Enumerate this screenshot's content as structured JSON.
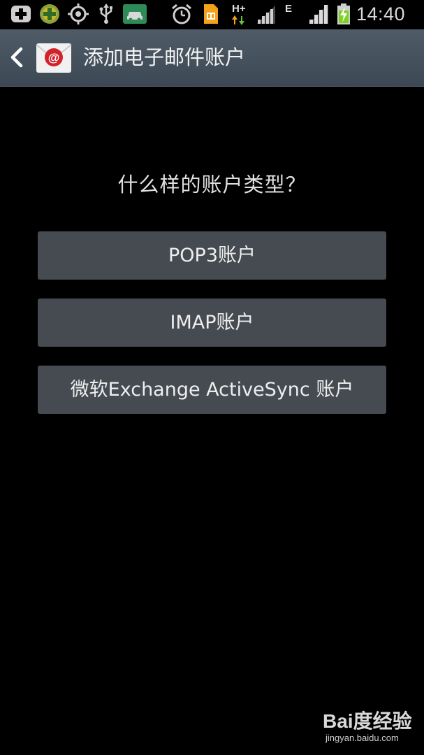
{
  "status_bar": {
    "network_type": "H+",
    "network_type_2": "E",
    "time": "14:40"
  },
  "action_bar": {
    "title": "添加电子邮件账户"
  },
  "content": {
    "question": "什么样的账户类型？",
    "options": [
      {
        "label": "POP3账户"
      },
      {
        "label": "IMAP账户"
      },
      {
        "label": "微软Exchange ActiveSync 账户"
      }
    ]
  },
  "watermark": {
    "brand": "Bai度经验",
    "url": "jingyan.baidu.com"
  },
  "colors": {
    "background": "#000000",
    "action_bar": "#46525e",
    "button": "#464b52",
    "email_icon_red": "#d2232a",
    "battery_green": "#7dd321"
  }
}
